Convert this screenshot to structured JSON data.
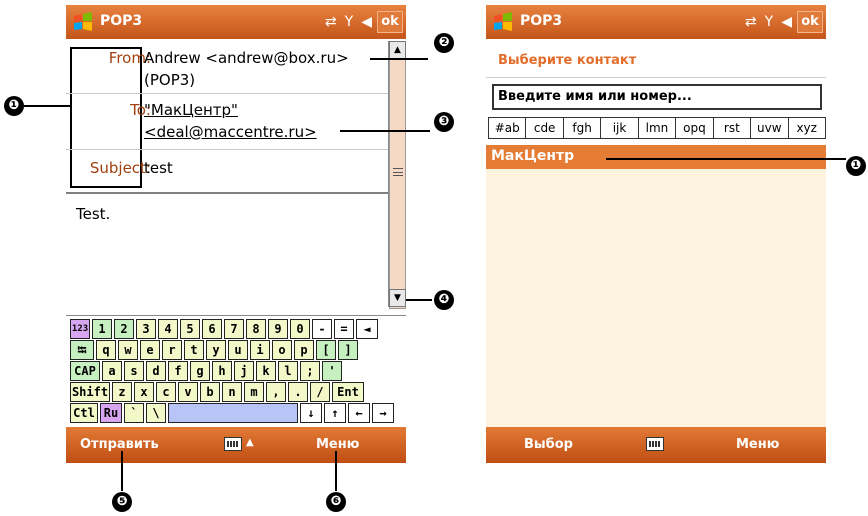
{
  "left_screen": {
    "title": "POP3",
    "ok_label": "ok",
    "status_icons": [
      "sync-icon",
      "signal-icon",
      "volume-icon"
    ],
    "header": {
      "from_label": "From:",
      "from_value_line1": "Andrew <andrew@box.ru>",
      "from_value_line2": "(POP3)",
      "to_label": "To:",
      "to_value_line1": "\"МакЦентр\"",
      "to_value_line2": "<deal@maccentre.ru>",
      "subject_label": "Subject:",
      "subject_value": "test"
    },
    "body_text": "Test.",
    "keyboard": {
      "rows": [
        [
          "123",
          "1",
          "2",
          "3",
          "4",
          "5",
          "6",
          "7",
          "8",
          "9",
          "0",
          "-",
          "=",
          "◄"
        ],
        [
          "⭾",
          "q",
          "w",
          "e",
          "r",
          "t",
          "y",
          "u",
          "i",
          "o",
          "p",
          "[",
          "]"
        ],
        [
          "CAP",
          "a",
          "s",
          "d",
          "f",
          "g",
          "h",
          "j",
          "k",
          "l",
          ";",
          "'"
        ],
        [
          "Shift",
          "z",
          "x",
          "c",
          "v",
          "b",
          "n",
          "m",
          ",",
          ".",
          "/",
          "Ent"
        ],
        [
          "Ctl",
          "Ru",
          "`",
          "\\",
          "",
          "↓",
          "↑",
          "←",
          "→"
        ]
      ]
    },
    "softkeys": {
      "left": "Отправить",
      "right": "Меню"
    }
  },
  "right_screen": {
    "title": "POP3",
    "ok_label": "ok",
    "select_title": "Выберите контакт",
    "search_placeholder": "Введите имя или номер...",
    "alpha_tabs": [
      "#ab",
      "cde",
      "fgh",
      "ijk",
      "lmn",
      "opq",
      "rst",
      "uvw",
      "xyz"
    ],
    "contact": "МакЦентр",
    "softkeys": {
      "left": "Выбор",
      "right": "Меню"
    }
  },
  "callouts": {
    "c1_left": "❶",
    "c2": "❷",
    "c3": "❸",
    "c4": "❹",
    "c5": "❺",
    "c6": "❻",
    "c1_right": "❶"
  },
  "colors": {
    "accent": "#e47c36",
    "titlebar": "#d06224",
    "label_text": "#a04010",
    "list_bg": "#fdf3df"
  }
}
